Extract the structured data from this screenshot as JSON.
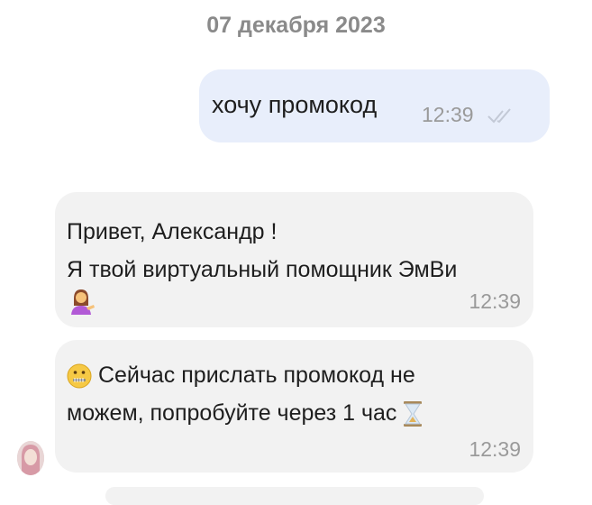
{
  "date_separator": "07 декабря 2023",
  "messages": [
    {
      "direction": "out",
      "text": "хочу промокод",
      "time": "12:39",
      "status_icon": "double-check-icon"
    },
    {
      "direction": "in",
      "line1": "Привет, Александр !",
      "line2": "Я твой виртуальный помощник ЭмВи",
      "line3_emoji": "woman-tipping-hand-emoji",
      "time": "12:39"
    },
    {
      "direction": "in",
      "line1_emoji": "zipper-mouth-face-emoji",
      "line1": "Сейчас прислать промокод не",
      "line2": "можем, попробуйте через 1 час",
      "line2_emoji": "hourglass-emoji",
      "time": "12:39"
    }
  ],
  "colors": {
    "outgoing_bubble": "#e8eefb",
    "incoming_bubble": "#f2f2f2",
    "timestamp": "#9a9a9a",
    "date_separator": "#8a8a8a"
  }
}
